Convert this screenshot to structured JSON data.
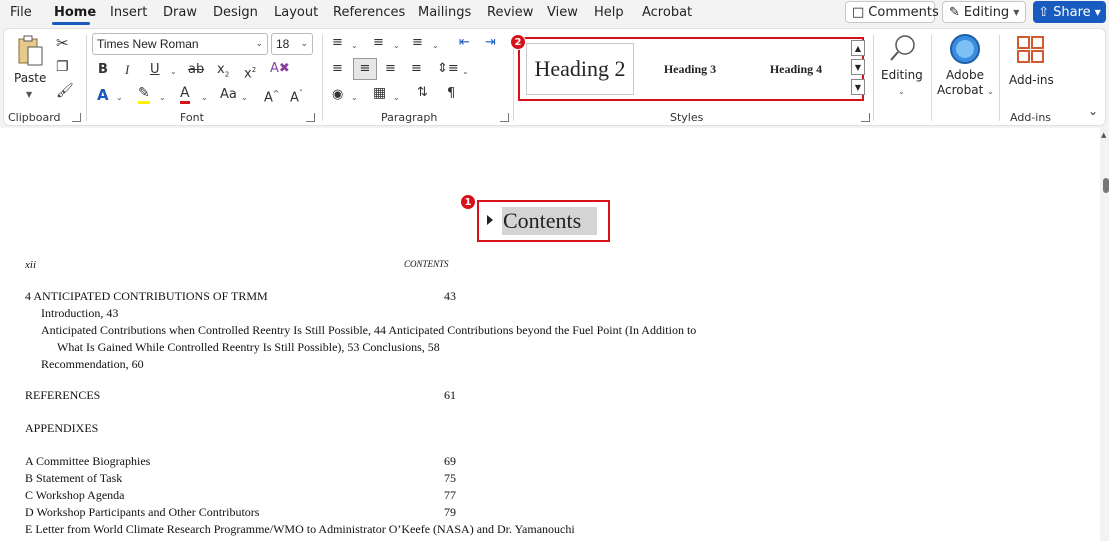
{
  "menu": {
    "tabs": [
      "File",
      "Home",
      "Insert",
      "Draw",
      "Design",
      "Layout",
      "References",
      "Mailings",
      "Review",
      "View",
      "Help",
      "Acrobat"
    ],
    "active": "Home",
    "comments_label": "Comments",
    "editing_label": "Editing",
    "share_label": "Share"
  },
  "ribbon": {
    "clipboard": {
      "paste_label": "Paste",
      "group_label": "Clipboard"
    },
    "font": {
      "family": "Times New Roman",
      "size": "18",
      "group_label": "Font",
      "bold": "B",
      "italic": "I",
      "underline": "U",
      "strike": "ab",
      "subscript": "x",
      "superscript": "x",
      "grow": "A",
      "shrink": "A",
      "case": "Aa"
    },
    "paragraph": {
      "group_label": "Paragraph",
      "pilcrow": "¶"
    },
    "styles": {
      "group_label": "Styles",
      "items": [
        "Heading 2",
        "Heading 3",
        "Heading 4"
      ]
    },
    "editing_label": "Editing",
    "adobe_label_1": "Adobe",
    "adobe_label_2": "Acrobat",
    "addins_label": "Add-ins",
    "addins_group_label": "Add-ins"
  },
  "badges": {
    "one": "1",
    "two": "2"
  },
  "colors": {
    "accent": "#185abd",
    "annotation": "#d9101a",
    "highlight": "#d4d4d4"
  },
  "document": {
    "heading": "Contents",
    "running_left": "xii",
    "running_right": "CONTENTS",
    "lines": [
      {
        "text": "4   ANTICIPATED CONTRIBUTIONS OF TRMM",
        "page": "43"
      },
      {
        "text": "Introduction, 43",
        "page": ""
      },
      {
        "text": "Anticipated Contributions when Controlled Reentry Is Still Possible, 44 Anticipated Contributions beyond the Fuel Point (In Addition to",
        "page": ""
      },
      {
        "text": "What Is Gained While Controlled Reentry Is Still Possible), 53 Conclusions, 58",
        "page": ""
      },
      {
        "text": "Recommendation, 60",
        "page": ""
      },
      {
        "text": "REFERENCES",
        "page": "61"
      },
      {
        "text": "APPENDIXES",
        "page": ""
      },
      {
        "text": "A  Committee Biographies",
        "page": "69"
      },
      {
        "text": "B  Statement of Task",
        "page": "75"
      },
      {
        "text": "C  Workshop Agenda",
        "page": "77"
      },
      {
        "text": "D  Workshop Participants and Other Contributors",
        "page": "79"
      },
      {
        "text": "E  Letter from World Climate Research Programme/WMO to Administrator O’Keefe (NASA) and Dr. Yamanouchi",
        "page": ""
      }
    ]
  }
}
